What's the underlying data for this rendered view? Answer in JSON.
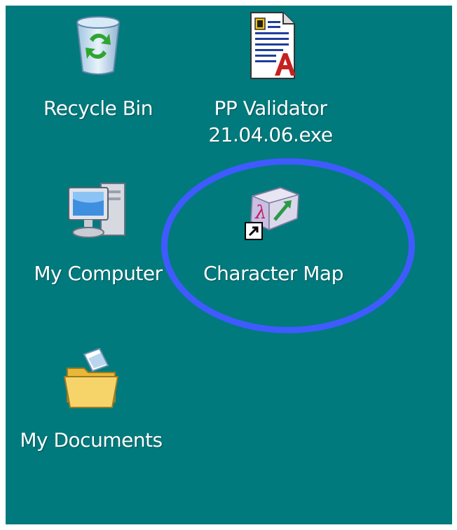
{
  "desktop": {
    "background_color": "#007a7d",
    "icons": [
      {
        "id": "recycle-bin",
        "label_lines": [
          "Recycle Bin"
        ],
        "icon": "recycle-bin-icon"
      },
      {
        "id": "pp-validator",
        "label_lines": [
          "PP Validator",
          "21.04.06.exe"
        ],
        "icon": "document-file-icon"
      },
      {
        "id": "my-computer",
        "label_lines": [
          "My Computer"
        ],
        "icon": "computer-icon"
      },
      {
        "id": "character-map",
        "label_lines": [
          "Character Map"
        ],
        "icon": "character-map-icon",
        "shortcut": true,
        "highlighted": true
      },
      {
        "id": "my-documents",
        "label_lines": [
          "My Documents"
        ],
        "icon": "folder-documents-icon"
      }
    ]
  },
  "highlight": {
    "color": "#3f5bff",
    "target": "character-map"
  }
}
